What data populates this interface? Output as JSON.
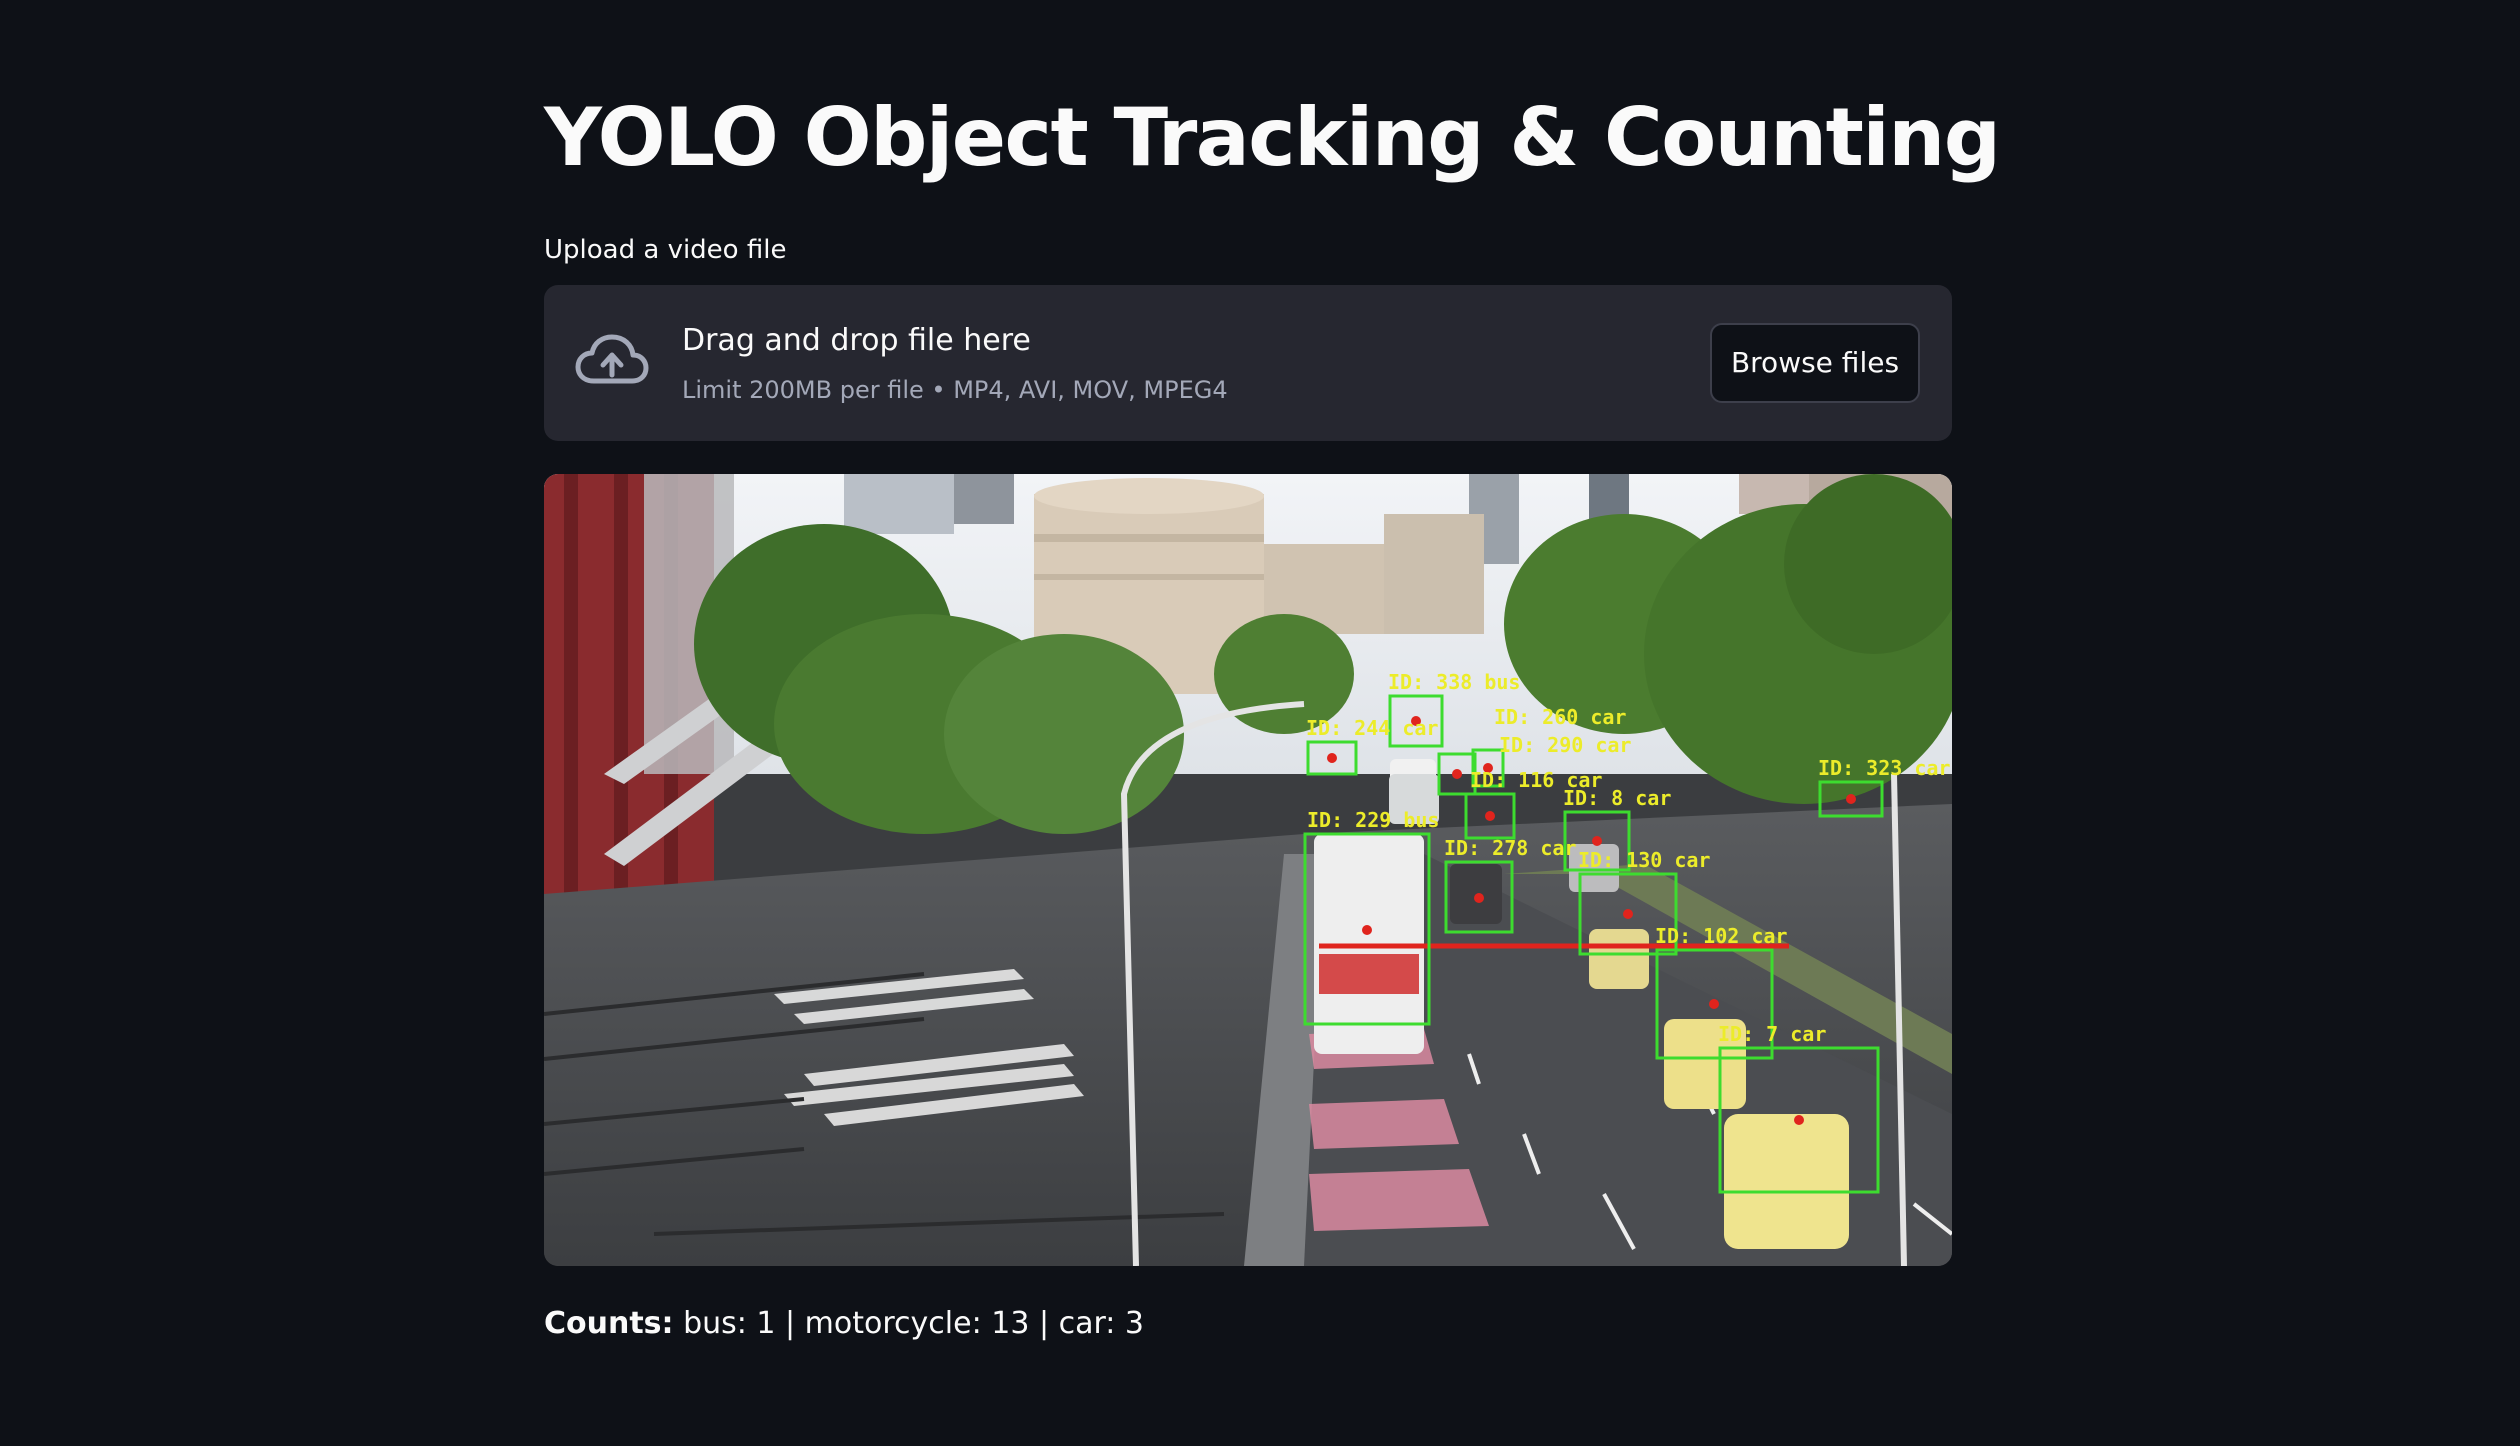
{
  "app": {
    "title": "YOLO Object Tracking & Counting"
  },
  "uploader": {
    "label": "Upload a video file",
    "drop_text": "Drag and drop file here",
    "limit_text": "Limit 200MB per file • MP4, AVI, MOV, MPEG4",
    "browse_label": "Browse files",
    "icon": "cloud-upload-icon"
  },
  "video": {
    "detections": [
      {
        "label": "ID: 229 bus"
      },
      {
        "label": "ID: 278 car"
      },
      {
        "label": "ID: 130 car"
      },
      {
        "label": "ID: 102 car"
      },
      {
        "label": "ID: 7 car"
      },
      {
        "label": "ID: 8 car"
      },
      {
        "label": "ID: 323 car"
      },
      {
        "label": "ID: 244 car"
      },
      {
        "label": "ID: 338 bus"
      },
      {
        "label": "ID: 260 car"
      },
      {
        "label": "ID: 290 car"
      },
      {
        "label": "ID: 116 car"
      }
    ],
    "box_color": "#3ddc2f",
    "label_color": "#ecec2a",
    "line_color": "#e0241d"
  },
  "results": {
    "counts_label": "Counts:",
    "counts_text": " bus: 1 | motorcycle: 13 | car: 3"
  }
}
